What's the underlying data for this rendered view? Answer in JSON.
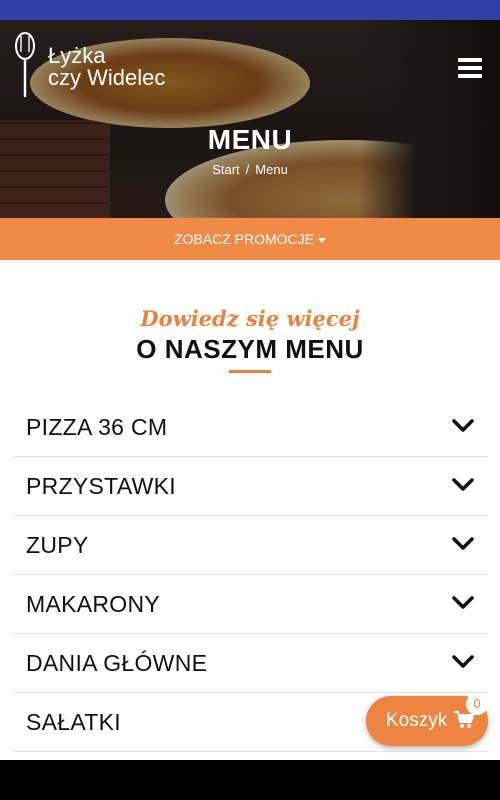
{
  "logo": {
    "line1": "Łyżka",
    "line2": "czy Widelec"
  },
  "hero": {
    "title": "MENU",
    "breadcrumb": {
      "home": "Start",
      "separator": "/",
      "current": "Menu"
    }
  },
  "promo": {
    "label": "ZOBACZ PROMOCJE"
  },
  "section": {
    "subtitle": "Dowiedz się więcej",
    "title": "O NASZYM MENU"
  },
  "categories": [
    {
      "label": "PIZZA 36 CM"
    },
    {
      "label": "PRZYSTAWKI"
    },
    {
      "label": "ZUPY"
    },
    {
      "label": "MAKARONY"
    },
    {
      "label": "DANIA GŁÓWNE"
    },
    {
      "label": "SAŁATKI"
    }
  ],
  "cart": {
    "label": "Koszyk",
    "count": "0"
  },
  "colors": {
    "accent": "#ee8441",
    "status_bar": "#3140a8",
    "text": "#111111"
  },
  "icons": {
    "menu": "hamburger-icon",
    "chevron": "chevron-down-icon",
    "cart": "cart-icon",
    "logo": "fork-spoon-icon"
  }
}
